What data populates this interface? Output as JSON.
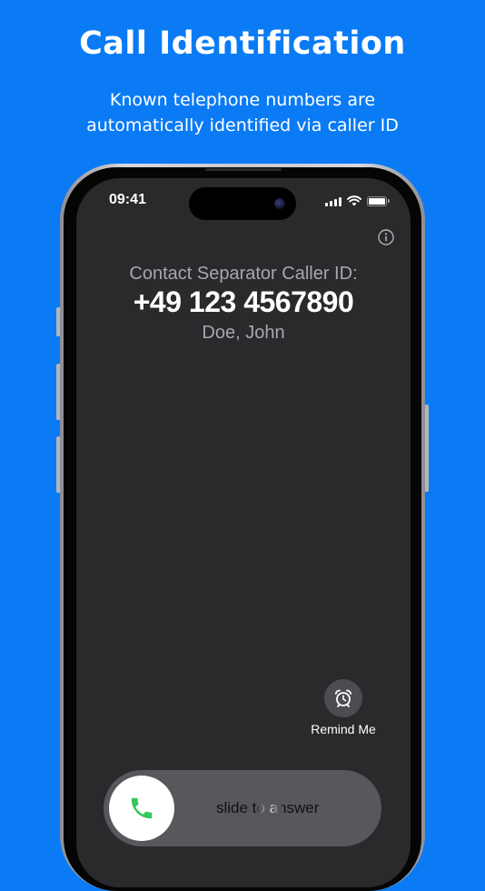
{
  "promo": {
    "title": "Call Identification",
    "subtitle": "Known telephone numbers are automatically identified via caller ID"
  },
  "status_bar": {
    "time": "09:41"
  },
  "incoming_call": {
    "label": "Contact Separator Caller ID:",
    "number": "+49 123 4567890",
    "name": "Doe, John"
  },
  "actions": {
    "remind_label": "Remind Me"
  },
  "slider": {
    "text": "slide to answer"
  },
  "colors": {
    "background": "#0a7bf5",
    "screen": "#2a292b",
    "accept_green": "#34c759"
  },
  "icons": {
    "info": "info-icon",
    "alarm": "alarm-clock-icon",
    "phone": "phone-icon",
    "wifi": "wifi-icon",
    "signal": "cellular-signal-icon",
    "battery": "battery-icon"
  }
}
